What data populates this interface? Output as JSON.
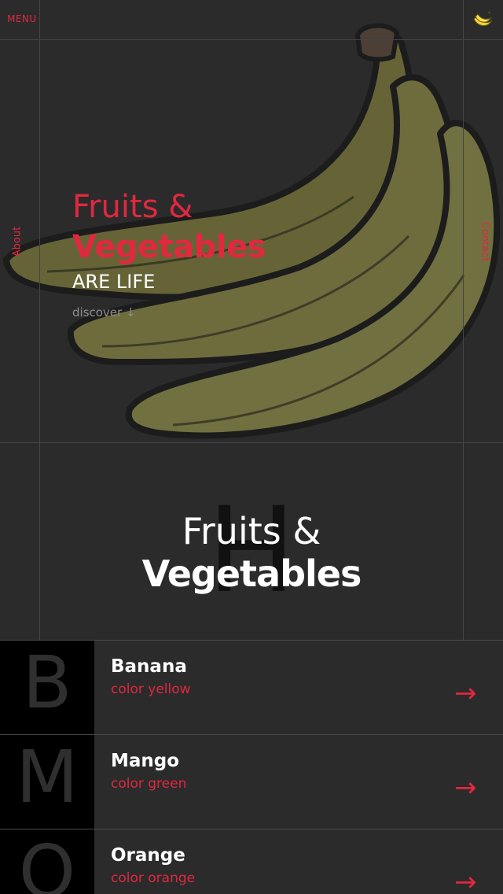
{
  "nav": {
    "menu_label": "MENU",
    "brand_icon": "banana-icon",
    "about_label": "About",
    "contact_label": "Contact"
  },
  "hero": {
    "title_line1": "Fruits &",
    "title_line2": "Vegetables",
    "tagline": "ARE LIFE",
    "discover_label": "discover ↓",
    "art": "banana-illustration",
    "art_color": "#6b6a3c"
  },
  "section": {
    "bg_letter": "H",
    "title_line1": "Fruits &",
    "title_line2": "Vegetables"
  },
  "items": [
    {
      "letter": "B",
      "name": "Banana",
      "color_text": "color yellow",
      "arrow": "→"
    },
    {
      "letter": "M",
      "name": "Mango",
      "color_text": "color green",
      "arrow": "→"
    },
    {
      "letter": "O",
      "name": "Orange",
      "color_text": "color orange",
      "arrow": "→"
    }
  ],
  "colors": {
    "accent": "#e0283f",
    "background": "#2b2b2b",
    "letter_box": "#000000"
  }
}
